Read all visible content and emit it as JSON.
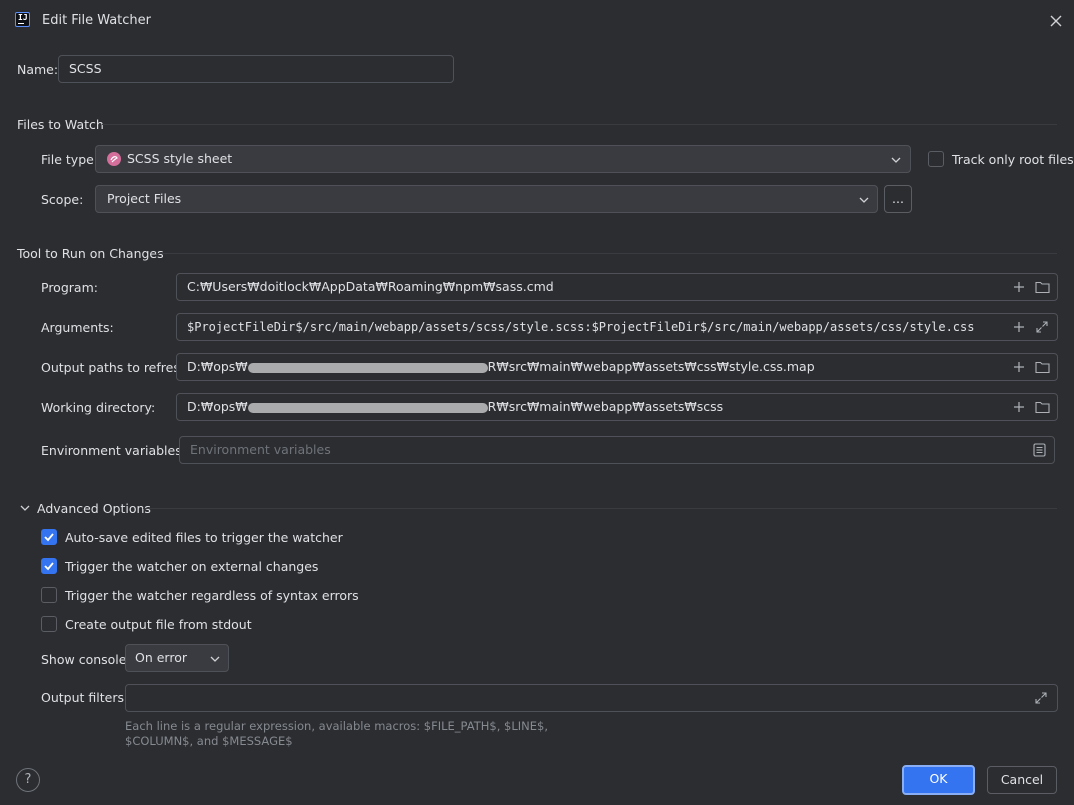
{
  "window": {
    "title": "Edit File Watcher",
    "app_icon_text": "IJ"
  },
  "name_field": {
    "label": "Name:",
    "value": "SCSS"
  },
  "files_to_watch": {
    "section_title": "Files to Watch",
    "file_type_label": "File type:",
    "file_type_value": "SCSS style sheet",
    "track_only_root_label": "Track only root files",
    "track_only_root_checked": false,
    "scope_label": "Scope:",
    "scope_value": "Project Files",
    "scope_more": "..."
  },
  "tool_to_run": {
    "section_title": "Tool to Run on Changes",
    "program_label": "Program:",
    "program_value": "C:₩Users₩doitlock₩AppData₩Roaming₩npm₩sass.cmd",
    "arguments_label": "Arguments:",
    "arguments_value": "$ProjectFileDir$/src/main/webapp/assets/scss/style.scss:$ProjectFileDir$/src/main/webapp/assets/css/style.css",
    "output_paths_label": "Output paths to refresh:",
    "output_paths_prefix": "D:₩ops₩",
    "output_paths_suffix": "R₩src₩main₩webapp₩assets₩css₩style.css.map",
    "working_dir_label": "Working directory:",
    "working_dir_prefix": "D:₩ops₩",
    "working_dir_suffix": "R₩src₩main₩webapp₩assets₩scss",
    "env_label": "Environment variables:",
    "env_placeholder": "Environment variables"
  },
  "advanced": {
    "section_title": "Advanced Options",
    "options": [
      {
        "label": "Auto-save edited files to trigger the watcher",
        "checked": true
      },
      {
        "label": "Trigger the watcher on external changes",
        "checked": true
      },
      {
        "label": "Trigger the watcher regardless of syntax errors",
        "checked": false
      },
      {
        "label": "Create output file from stdout",
        "checked": false
      }
    ],
    "show_console_label": "Show console:",
    "show_console_value": "On error",
    "output_filters_label": "Output filters:",
    "output_filters_value": "",
    "hint_line1": "Each line is a regular expression, available macros: $FILE_PATH$, $LINE$,",
    "hint_line2": "$COLUMN$, and $MESSAGE$"
  },
  "footer": {
    "help": "?",
    "ok": "OK",
    "cancel": "Cancel"
  },
  "colors": {
    "background": "#2b2d30",
    "accent": "#3574f0",
    "border": "#4e5157",
    "scss_icon": "#d36f9a"
  }
}
